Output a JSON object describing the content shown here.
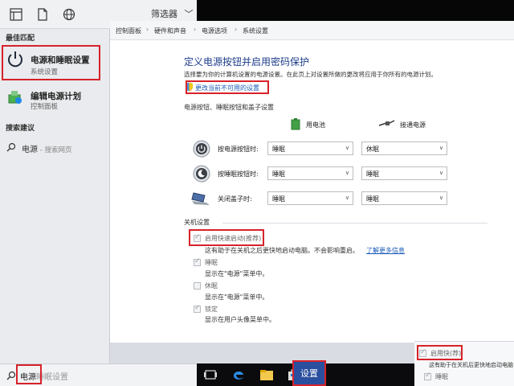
{
  "start_menu": {
    "filter_label": "筛选器",
    "section_best_match": "最佳匹配",
    "best_match": {
      "title": "电源和睡眠设置",
      "subtitle": "系统设置"
    },
    "second_result": {
      "title": "编辑电源计划",
      "subtitle": "控制面板"
    },
    "section_suggestions": "搜索建议",
    "suggestion": {
      "term": "电源",
      "hint": " - 搜索网页"
    },
    "search_box": {
      "query": "电源",
      "ghost": "睡眠设置"
    }
  },
  "control_panel": {
    "breadcrumbs": [
      "控制面板",
      "硬件和声音",
      "电源选项",
      "系统设置"
    ],
    "title": "定义电源按钮并启用密码保护",
    "description": "选择要为你的计算机设置的电源设置。在此页上对设置所做的更改将应用于你所有的电源计划。",
    "change_link": "更改当前不可用的设置",
    "section_buttons": "电源按钮、睡眠按钮和盖子设置",
    "col_battery": "用电池",
    "col_plugged": "接通电源",
    "rows": [
      {
        "label": "按电源按钮时:",
        "battery": "睡眠",
        "plugged": "休眠"
      },
      {
        "label": "按睡眠按钮时:",
        "battery": "睡眠",
        "plugged": "睡眠"
      },
      {
        "label": "关闭盖子时:",
        "battery": "睡眠",
        "plugged": "睡眠"
      }
    ],
    "section_shutdown": "关机设置",
    "fast_startup": {
      "label": "启用快速启动(推荐)",
      "desc": "这有助于在关机之后更快地启动电脑。不会影响重启。",
      "link": "了解更多信息"
    },
    "sleep_opt": {
      "label": "睡眠",
      "desc": "显示在\"电源\"菜单中。"
    },
    "hibernate_opt": {
      "label": "休眠",
      "desc": "显示在\"电源\"菜单中。"
    },
    "lock_opt": {
      "label": "锁定",
      "desc": "显示在用户头像菜单中。"
    }
  },
  "bottom_right": {
    "fast_startup_label": "启用快",
    "fast_startup_suffix": "(荐)",
    "desc": "这有助于在关机后更快地启动电脑",
    "sleep_label": "睡眠"
  },
  "taskbar": {
    "settings_label": "设置"
  },
  "colors": {
    "accent_red": "#d7222a",
    "link_blue": "#1a5bb8",
    "title_blue": "#1c3c8a",
    "taskbar": "#0b0b0d"
  }
}
